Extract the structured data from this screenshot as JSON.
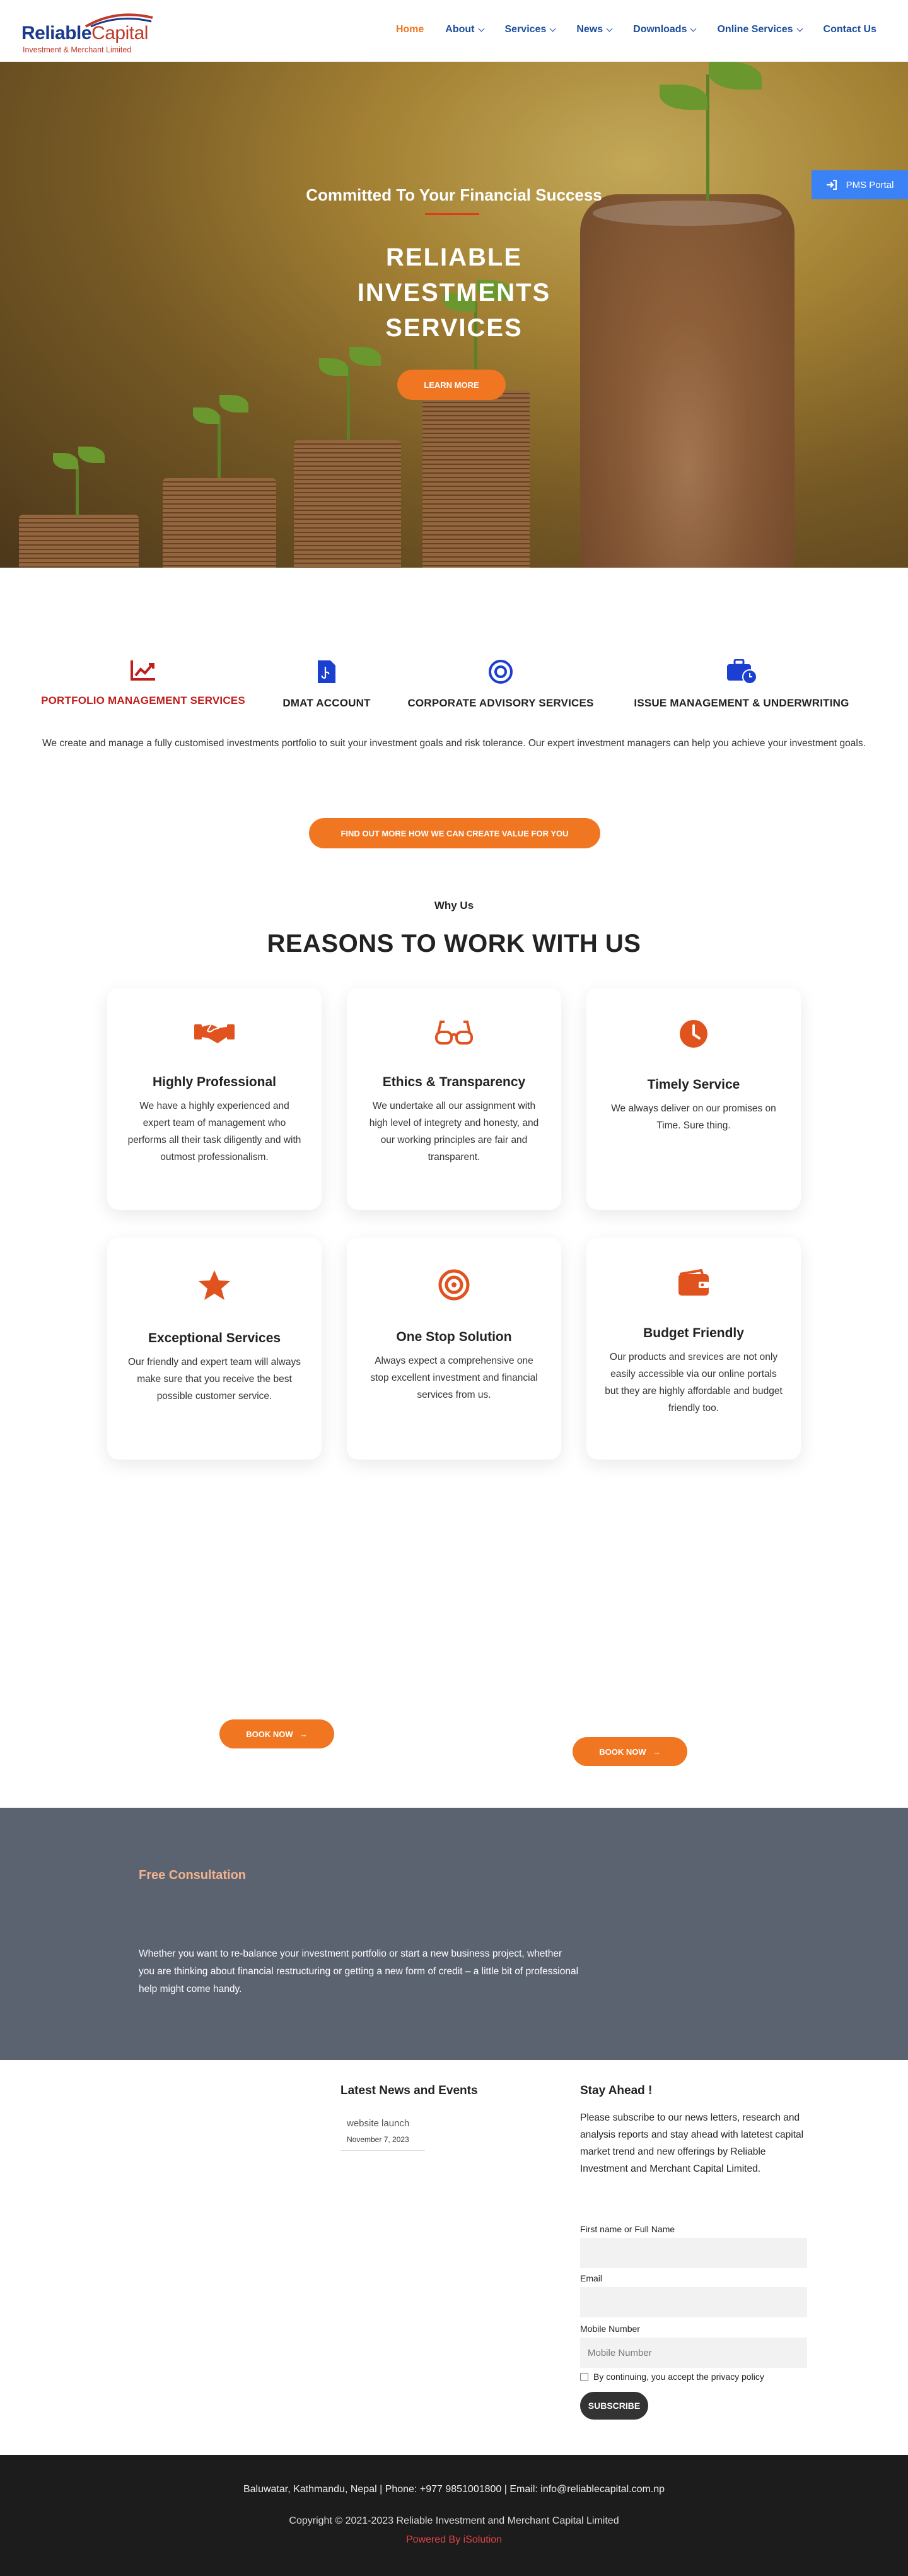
{
  "brand": {
    "name_part1": "Reliable",
    "name_part2": "Capital",
    "subtitle": "Investment & Merchant Limited"
  },
  "nav": [
    {
      "label": "Home",
      "active": true,
      "dropdown": false
    },
    {
      "label": "About",
      "dropdown": true
    },
    {
      "label": "Services",
      "dropdown": true
    },
    {
      "label": "News",
      "dropdown": true
    },
    {
      "label": "Downloads",
      "dropdown": true
    },
    {
      "label": "Online Services",
      "dropdown": true
    },
    {
      "label": "Contact Us",
      "dropdown": false
    }
  ],
  "hero": {
    "kicker": "Committed To Your Financial Success",
    "title": "RELIABLE INVESTMENTS SERVICES",
    "button": "LEARN MORE",
    "pms_portal": "PMS Portal"
  },
  "services": {
    "items": [
      {
        "label": "PORTFOLIO MANAGEMENT SERVICES",
        "icon": "chart-line-icon",
        "active": true
      },
      {
        "label": "DMAT ACCOUNT",
        "icon": "document-icon"
      },
      {
        "label": "CORPORATE ADVISORY SERVICES",
        "icon": "target-ring-icon"
      },
      {
        "label": "ISSUE MANAGEMENT & UNDERWRITING",
        "icon": "briefcase-clock-icon"
      }
    ],
    "description": "We create and manage a fully customised investments portfolio to suit your investment goals and risk tolerance. Our expert investment managers can help you achieve your investment goals.",
    "button": "FIND OUT MORE HOW WE CAN CREATE VALUE FOR YOU"
  },
  "why": {
    "kicker": "Why Us",
    "title": "REASONS TO WORK WITH US",
    "cards": [
      {
        "title": "Highly Professional",
        "icon": "handshake-icon",
        "text": "We have a highly experienced and expert team of management who performs all their task diligently and with outmost professionalism."
      },
      {
        "title": "Ethics & Transparency",
        "icon": "glasses-icon",
        "text": "We undertake all our assignment with high level of integrety and honesty, and our working principles are fair and transparent."
      },
      {
        "title": "Timely Service",
        "icon": "clock-icon",
        "text": "We always deliver on our promises on Time. Sure thing."
      },
      {
        "title": "Exceptional Services",
        "icon": "star-icon",
        "text": "Our friendly and expert team will always make sure that you receive the best possible customer service."
      },
      {
        "title": "One Stop Solution",
        "icon": "bullseye-icon",
        "text": "Always expect a comprehensive one stop excellent investment and financial services from us."
      },
      {
        "title": "Budget Friendly",
        "icon": "wallet-icon",
        "text": "Our products and srevices are not only easily accessible via our online portals but they are highly affordable and budget friendly too."
      }
    ],
    "book_label": "BOOK NOW",
    "arrow": "→"
  },
  "consultation": {
    "title": "Free Consultation",
    "text": "Whether you want to re-balance your investment portfolio or start a new business project, whether you are thinking about financial restructuring or getting a new form of credit – a little bit of professional help might come handy."
  },
  "news": {
    "title": "Latest News and Events",
    "items": [
      {
        "title": "website launch",
        "date": "November 7, 2023"
      }
    ]
  },
  "subscribe": {
    "title": "Stay Ahead !",
    "text": "Please subscribe to our news letters, research and analysis reports and stay ahead with latetest capital market trend and new offerings by Reliable Investment and Merchant Capital Limited.",
    "name_label": "First name or Full Name",
    "email_label": "Email",
    "mobile_label": "Mobile Number",
    "mobile_placeholder": "Mobile Number",
    "consent": "By continuing, you accept the privacy policy",
    "button": "SUBSCRIBE"
  },
  "footer": {
    "contact": "Baluwatar, Kathmandu, Nepal | Phone: +977 9851001800 | Email: info@reliablecapital.com.np",
    "copyright": "Copyright © 2021-2023 Reliable Investment and Merchant Capital Limited",
    "powered": "Powered By iSolution"
  },
  "colors": {
    "accent": "#f07621",
    "brand_blue": "#1b4d9b",
    "brand_red": "#c21d1d",
    "card_icon": "#e0531e",
    "pms_blue": "#3b82f6",
    "consult_bg": "#5b6370",
    "footer_bg": "#1c1c1c"
  }
}
